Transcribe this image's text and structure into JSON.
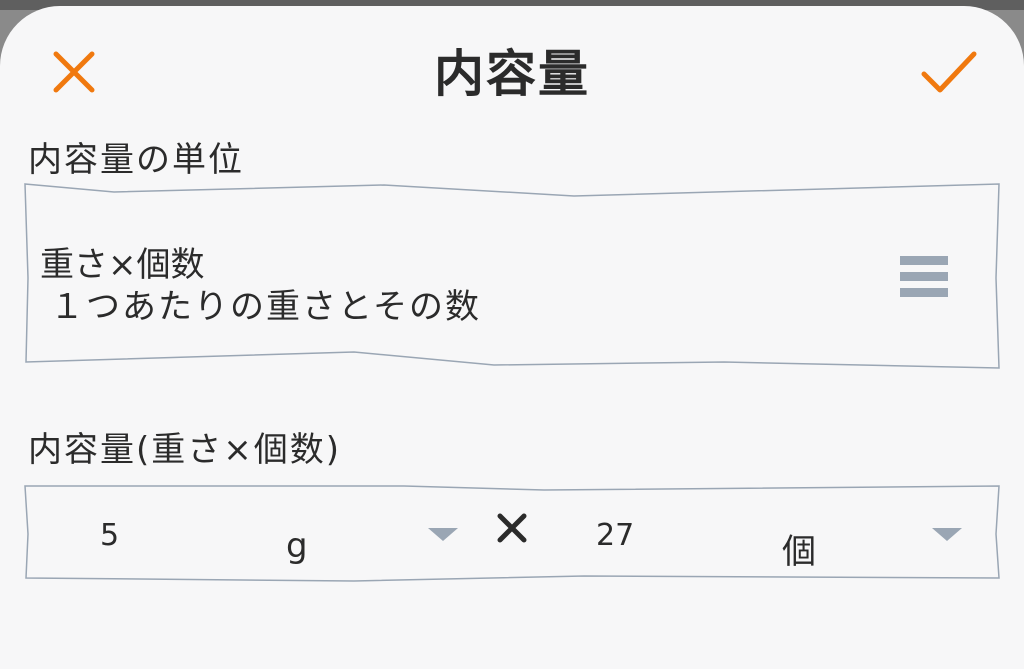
{
  "header": {
    "title": "内容量",
    "close_icon": "close-icon",
    "confirm_icon": "check-icon"
  },
  "unit_section": {
    "label": "内容量の単位",
    "selected_main": "重さ×個数",
    "selected_sub": "１つあたりの重さとその数",
    "menu_icon": "menu-icon"
  },
  "amount_section": {
    "label": "内容量(重さ×個数)",
    "weight_value": "5",
    "weight_unit": "g",
    "count_value": "27",
    "count_unit": "個"
  },
  "colors": {
    "accent": "#f0790f",
    "icon_gray": "#9aa6b4",
    "text": "#2b2b2b",
    "background": "#f7f7f8"
  }
}
